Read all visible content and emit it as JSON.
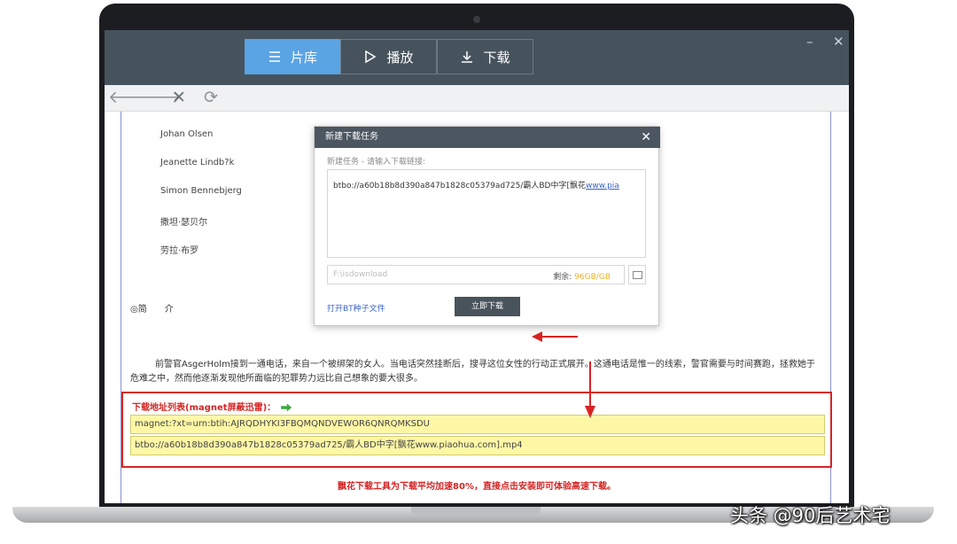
{
  "app": {
    "tabs": [
      {
        "label": "片库",
        "icon": "menu-icon",
        "active": true
      },
      {
        "label": "播放",
        "icon": "play-icon",
        "active": false
      },
      {
        "label": "下载",
        "icon": "download-icon",
        "active": false
      }
    ],
    "window_controls": {
      "minimize": "–",
      "close": "✕"
    }
  },
  "navbar": {
    "back": "🡐",
    "forward": "🡒",
    "stop": "✕",
    "refresh": "⟳"
  },
  "page": {
    "cast": [
      "Johan Olsen",
      "Jeanette Lindb?k",
      "Simon Bennebjerg",
      "撒坦·瑟贝尔",
      "劳拉·布罗"
    ],
    "intro_label": "◎简　　介",
    "intro_text": "前警官AsgerHolm接到一通电话，来自一个被绑架的女人。当电话突然挂断后，搜寻这位女性的行动正式展开。这通电话是惟一的线索，警官需要与时间赛跑，拯救她于危难之中，然而他逐渐发现他所面临的犯罪势力远比自己想象的要大很多。",
    "download_list": {
      "title": "下载地址列表(magnet屏蔽迅雷)：",
      "links": [
        "magnet:?xt=urn:btih:AJRQDHYKI3FBQMQNDVEWOR6QNRQMKSDU",
        "btbo://a60b18b8d390a847b1828c05379ad725/霸人BD中字[飘花www.piaohua.com].mp4"
      ]
    },
    "promo": "飘花下载工具为下载平均加速80%，直接点击安装即可体验高速下载。"
  },
  "dialog": {
    "title": "新建下载任务",
    "close": "✕",
    "subtitle": "新建任务 - 请输入下载链接:",
    "link_text": "btbo://a60b18b8d390a847b1828c05379ad725/霸人BD中字[飘花",
    "link_url": "www.pia",
    "save_path": "F:\\isdownload",
    "space_label": "剩余:",
    "space_value": "96GB/GB",
    "open_bt": "打开BT种子文件",
    "download_now": "立即下载"
  },
  "watermark": "头条 @90后艺术宅",
  "colors": {
    "accent_tab": "#5aa4e4",
    "title_bar": "#46535d",
    "annotation_red": "#d62424",
    "link_row_bg": "#fdf7a6"
  }
}
